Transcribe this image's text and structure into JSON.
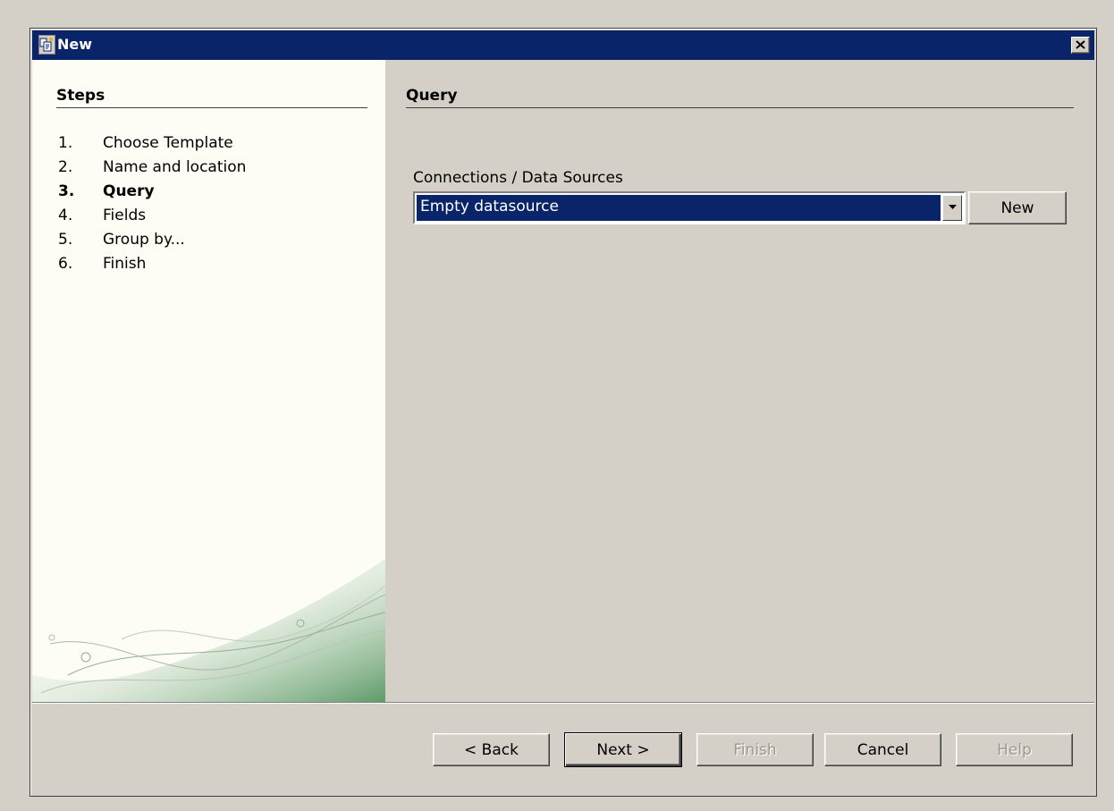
{
  "window": {
    "title": "New",
    "icon": "wizard-app-icon",
    "close_icon": "close-icon"
  },
  "steps": {
    "heading": "Steps",
    "items": [
      {
        "num": "1.",
        "label": "Choose Template",
        "current": false
      },
      {
        "num": "2.",
        "label": "Name and location",
        "current": false
      },
      {
        "num": "3.",
        "label": "Query",
        "current": true
      },
      {
        "num": "4.",
        "label": "Fields",
        "current": false
      },
      {
        "num": "5.",
        "label": "Group by...",
        "current": false
      },
      {
        "num": "6.",
        "label": "Finish",
        "current": false
      }
    ]
  },
  "content": {
    "title": "Query",
    "connections_label": "Connections / Data Sources",
    "connections_value": "Empty datasource",
    "new_label": "New"
  },
  "footer": {
    "back_label": "< Back",
    "next_label": "Next >",
    "finish_label": "Finish",
    "cancel_label": "Cancel",
    "help_label": "Help"
  },
  "colors": {
    "titlebar": "#0a246a",
    "face": "#d4d0c8",
    "steps_bg": "#fdfdf5",
    "selection": "#0a246a",
    "decor_green": "#5e9b68"
  }
}
